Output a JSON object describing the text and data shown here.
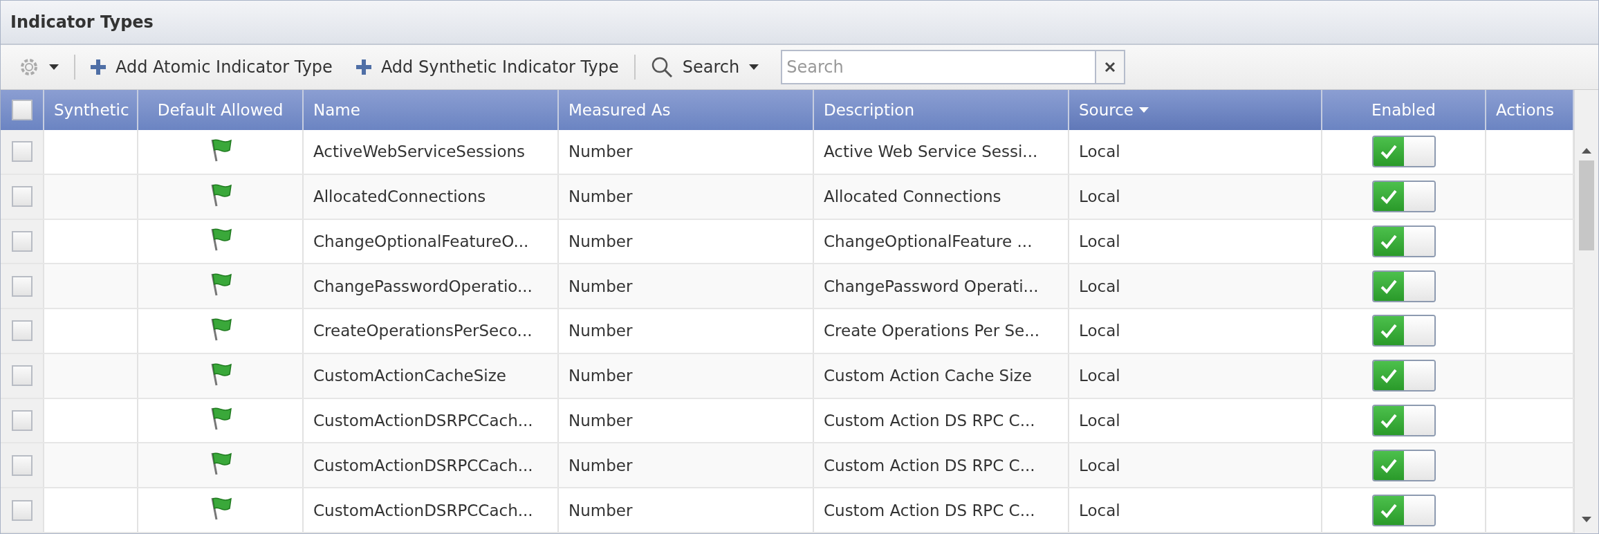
{
  "panel": {
    "title": "Indicator Types"
  },
  "toolbar": {
    "buttons": [
      "Add Atomic Indicator Type",
      "Add Synthetic Indicator Type"
    ],
    "search_menu": "Search",
    "search": {
      "placeholder": "Search"
    }
  },
  "table": {
    "header_checked": false,
    "columns": [
      {
        "label": "Synthetic",
        "sorted": false
      },
      {
        "label": "Default Allowed",
        "sorted": false
      },
      {
        "label": "Name",
        "sorted": false
      },
      {
        "label": "Measured As",
        "sorted": false
      },
      {
        "label": "Description",
        "sorted": false
      },
      {
        "label": "Source",
        "sorted": true
      },
      {
        "label": "Enabled",
        "sorted": false
      },
      {
        "label": "Actions",
        "sorted": false
      }
    ],
    "rows": [
      {
        "checked": false,
        "default_allowed": true,
        "name": "ActiveWebServiceSessions",
        "measured_as": "Number",
        "description": "Active Web Service Sessi...",
        "source": "Local",
        "enabled": true
      },
      {
        "checked": false,
        "default_allowed": true,
        "name": "AllocatedConnections",
        "measured_as": "Number",
        "description": "Allocated Connections",
        "source": "Local",
        "enabled": true
      },
      {
        "checked": false,
        "default_allowed": true,
        "name": "ChangeOptionalFeatureO...",
        "measured_as": "Number",
        "description": "ChangeOptionalFeature ...",
        "source": "Local",
        "enabled": true
      },
      {
        "checked": false,
        "default_allowed": true,
        "name": "ChangePasswordOperatio...",
        "measured_as": "Number",
        "description": "ChangePassword Operati...",
        "source": "Local",
        "enabled": true
      },
      {
        "checked": false,
        "default_allowed": true,
        "name": "CreateOperationsPerSeco...",
        "measured_as": "Number",
        "description": "Create Operations Per Se...",
        "source": "Local",
        "enabled": true
      },
      {
        "checked": false,
        "default_allowed": true,
        "name": "CustomActionCacheSize",
        "measured_as": "Number",
        "description": "Custom Action Cache Size",
        "source": "Local",
        "enabled": true
      },
      {
        "checked": false,
        "default_allowed": true,
        "name": "CustomActionDSRPCCach...",
        "measured_as": "Number",
        "description": "Custom Action DS RPC C...",
        "source": "Local",
        "enabled": true
      },
      {
        "checked": false,
        "default_allowed": true,
        "name": "CustomActionDSRPCCach...",
        "measured_as": "Number",
        "description": "Custom Action DS RPC C...",
        "source": "Local",
        "enabled": true
      },
      {
        "checked": false,
        "default_allowed": true,
        "name": "CustomActionDSRPCCach...",
        "measured_as": "Number",
        "description": "Custom Action DS RPC C...",
        "source": "Local",
        "enabled": true
      }
    ]
  }
}
